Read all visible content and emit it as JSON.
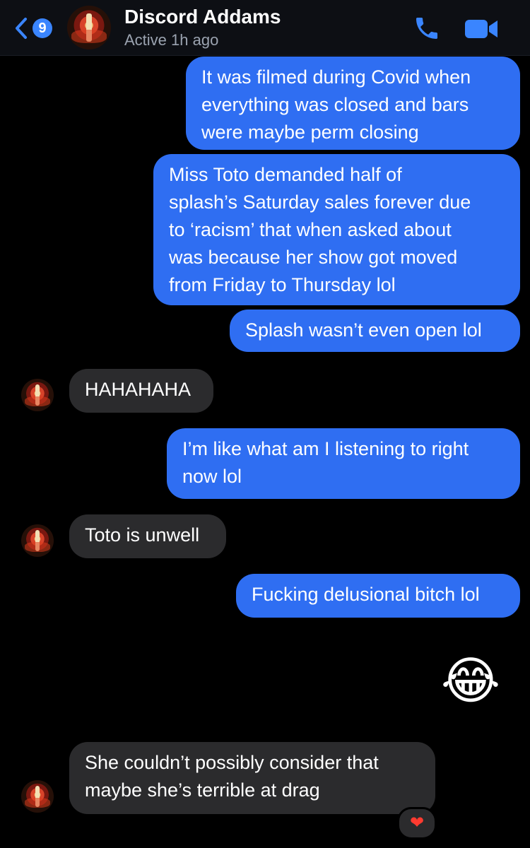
{
  "header": {
    "unread_count": "9",
    "contact_name": "Discord Addams",
    "status": "Active 1h ago"
  },
  "messages": [
    {
      "from": "me",
      "text": "It was filmed during Covid when\neverything was closed and bars\nwere maybe perm closing"
    },
    {
      "from": "me",
      "text": "Miss Toto demanded half of\nsplash’s Saturday sales forever due\nto ‘racism’ that when asked about\nwas because her show got moved\nfrom Friday to Thursday lol"
    },
    {
      "from": "me",
      "text": "Splash wasn’t even open lol"
    },
    {
      "from": "them",
      "text": "HAHAHAHA"
    },
    {
      "from": "me",
      "text": "I’m like what am I listening to right\nnow lol"
    },
    {
      "from": "them",
      "text": "Toto is unwell"
    },
    {
      "from": "me",
      "text": "Fucking delusional bitch lol"
    },
    {
      "from": "me",
      "emoji": "😂"
    },
    {
      "from": "them",
      "text": "She couldn’t possibly consider that\nmaybe she’s terrible at drag",
      "reaction": "❤"
    }
  ],
  "colors": {
    "sent_bubble": "#2f6ef2",
    "received_bubble": "#2b2b2d",
    "accent": "#3a85ff"
  },
  "icons": [
    "back-chevron-icon",
    "phone-icon",
    "video-camera-icon"
  ]
}
